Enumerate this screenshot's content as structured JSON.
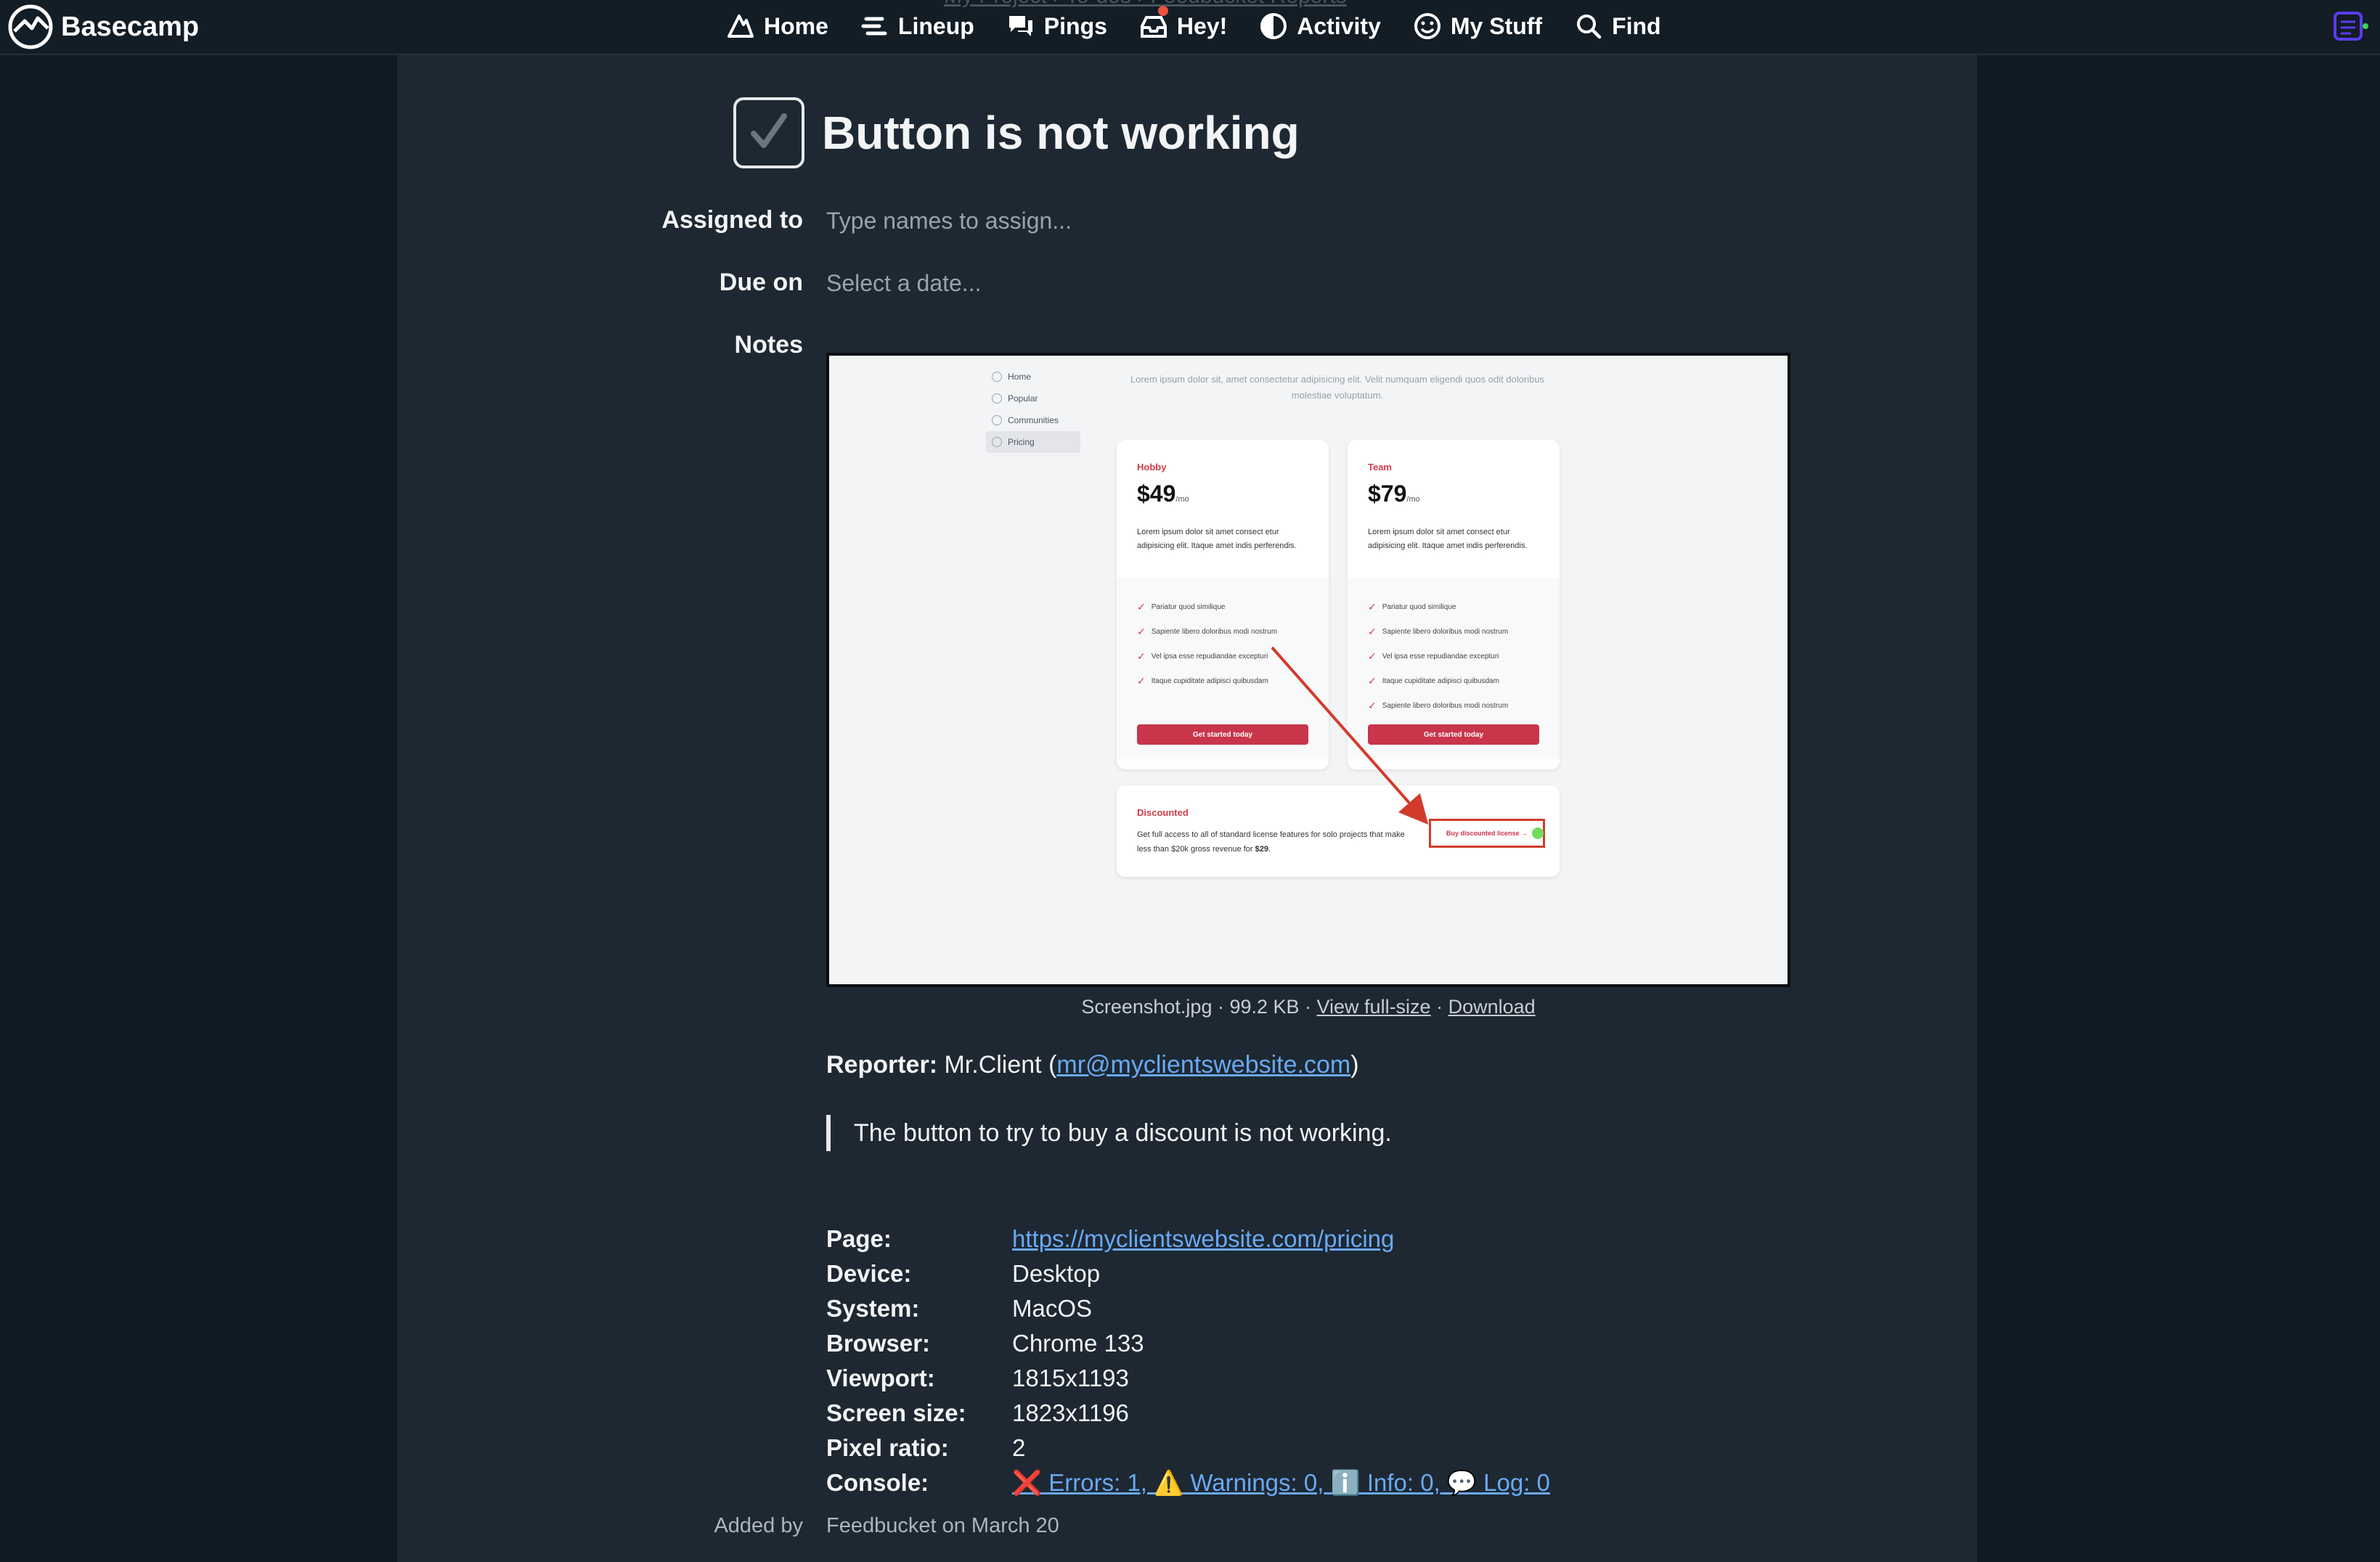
{
  "nav": {
    "brand": "Basecamp",
    "items": [
      "Home",
      "Lineup",
      "Pings",
      "Hey!",
      "Activity",
      "My Stuff",
      "Find"
    ],
    "ghost_breadcrumb": "My Project › To-dos › Feedbucket Reports"
  },
  "todo": {
    "title": "Button is not working",
    "assigned_label": "Assigned to",
    "assigned_placeholder": "Type names to assign...",
    "due_label": "Due on",
    "due_placeholder": "Select a date...",
    "notes_label": "Notes"
  },
  "attachment": {
    "info": "Screenshot.jpg · 99.2 KB · ",
    "view_full": "View full-size",
    "sep": " · ",
    "download": "Download",
    "screenshot": {
      "sidebar": [
        "Home",
        "Popular",
        "Communities",
        "Pricing"
      ],
      "subtitle": "Lorem ipsum dolor sit, amet consectetur adipisicing elit. Velit numquam eligendi quos odit doloribus molestiae voluptatum.",
      "plans": [
        {
          "tier": "Hobby",
          "price": "$49",
          "per": "/mo",
          "desc": "Lorem ipsum dolor sit amet consect etur adipisicing elit. Itaque amet indis perferendis.",
          "features": [
            "Pariatur quod similique",
            "Sapiente libero doloribus modi nostrum",
            "Vel ipsa esse repudiandae excepturi",
            "Itaque cupiditate adipisci quibusdam"
          ],
          "button": "Get started today"
        },
        {
          "tier": "Team",
          "price": "$79",
          "per": "/mo",
          "desc": "Lorem ipsum dolor sit amet consect etur adipisicing elit. Itaque amet indis perferendis.",
          "features": [
            "Pariatur quod similique",
            "Sapiente libero doloribus modi nostrum",
            "Vel ipsa esse repudiandae excepturi",
            "Itaque cupiditate adipisci quibusdam",
            "Sapiente libero doloribus modi nostrum"
          ],
          "button": "Get started today"
        }
      ],
      "discount": {
        "title": "Discounted",
        "desc_prefix": "Get full access to all of standard license features for solo projects that make less than $20k gross revenue for ",
        "desc_price": "$29",
        "desc_suffix": ".",
        "button": "Buy discounted license →"
      }
    }
  },
  "report": {
    "reporter_label": "Reporter:",
    "reporter_name": " Mr.Client (",
    "reporter_email": "mr@myclientswebsite.com",
    "reporter_close": ")",
    "quote": "The button to try to buy a discount is not working.",
    "meta": [
      {
        "key": "Page:",
        "value": "https://myclientswebsite.com/pricing",
        "link": true
      },
      {
        "key": "Device:",
        "value": "Desktop"
      },
      {
        "key": "System:",
        "value": "MacOS"
      },
      {
        "key": "Browser:",
        "value": "Chrome 133"
      },
      {
        "key": "Viewport:",
        "value": "1815x1193"
      },
      {
        "key": "Screen size:",
        "value": "1823x1196"
      },
      {
        "key": "Pixel ratio:",
        "value": "2"
      },
      {
        "key": "Console:",
        "value": "❌ Errors: 1, ⚠️ Warnings: 0, ℹ️ Info: 0, 💬 Log: 0",
        "link": true
      }
    ],
    "added_label": "Added by",
    "added_value": "Feedbucket on March 20"
  },
  "colors": {
    "accent": "#6aa9f4",
    "background": "#0f1a22",
    "panel": "#1d2832",
    "brand_red": "#c9354a"
  }
}
